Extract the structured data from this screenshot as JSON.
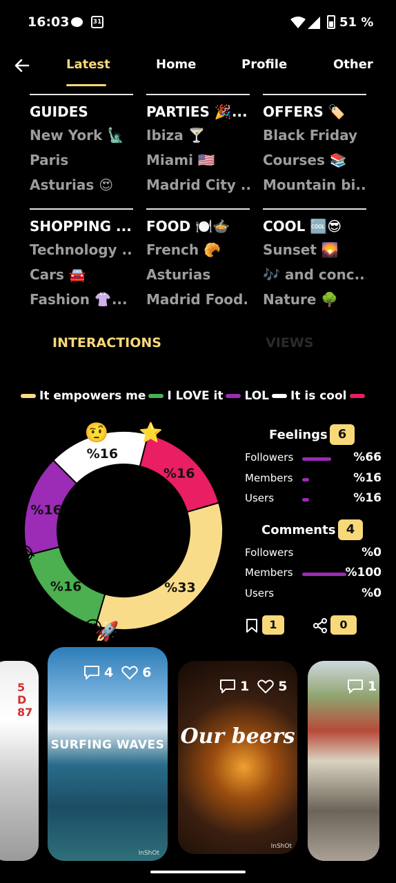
{
  "status_bar": {
    "time": "16:03",
    "calendar_day": "31",
    "battery": "51 %"
  },
  "nav": {
    "tabs": [
      "Latest",
      "Home",
      "Profile",
      "Other"
    ],
    "active_tab": "Latest"
  },
  "categories": [
    {
      "title": "GUIDES",
      "items": [
        "New York 🗽",
        "Paris",
        "Asturias 😍"
      ]
    },
    {
      "title": "PARTIES 🎉...",
      "items": [
        "Ibiza 🍸",
        "Miami 🇺🇸",
        "Madrid City ..."
      ]
    },
    {
      "title": "OFFERS 🏷️",
      "items": [
        "Black Friday",
        "Courses 📚",
        "Mountain bi..."
      ]
    },
    {
      "title": "SHOPPING ...",
      "items": [
        "Technology ...",
        "Cars 🚘",
        "Fashion 👚..."
      ]
    },
    {
      "title": "FOOD 🍽️🍲",
      "items": [
        "French 🥐",
        "Asturias",
        "Madrid Food..."
      ]
    },
    {
      "title": "COOL 🆒😎",
      "items": [
        "Sunset 🌄",
        "🎶 and conc...",
        "Nature 🌳"
      ]
    }
  ],
  "interaction_tabs": {
    "interactions": "INTERACTIONS",
    "views": "VIEWS"
  },
  "legend": [
    {
      "label": "It empowers me",
      "color": "#f8dc8a"
    },
    {
      "label": "I LOVE it",
      "color": "#4caf50"
    },
    {
      "label": "LOL",
      "color": "#9c2bb5"
    },
    {
      "label": "It is cool",
      "color": "#ffffff"
    },
    {
      "label": "",
      "color": "#e91e63"
    }
  ],
  "chart_data": {
    "type": "pie",
    "donut": true,
    "categories": [
      "It is cool",
      "Star",
      "It empowers me",
      "I LOVE it",
      "LOL"
    ],
    "values": [
      16,
      16,
      33,
      16,
      16
    ],
    "labels": [
      "%16",
      "%16",
      "%33",
      "%16",
      "%16"
    ],
    "colors": [
      "#ffffff",
      "#e91e63",
      "#f8dc8a",
      "#4caf50",
      "#9c2bb5"
    ],
    "emojis": [
      "🤨",
      "⭐",
      "🚀",
      "😍",
      "😂"
    ]
  },
  "feelings": {
    "title": "Feelings",
    "count": "6",
    "rows": [
      {
        "label": "Followers",
        "value": "%66",
        "fraction": 0.66
      },
      {
        "label": "Members",
        "value": "%16",
        "fraction": 0.16
      },
      {
        "label": "Users",
        "value": "%16",
        "fraction": 0.16
      }
    ]
  },
  "comments": {
    "title": "Comments",
    "count": "4",
    "rows": [
      {
        "label": "Followers",
        "value": "%0",
        "fraction": 0
      },
      {
        "label": "Members",
        "value": "%100",
        "fraction": 1.0
      },
      {
        "label": "Users",
        "value": "%0",
        "fraction": 0
      }
    ]
  },
  "actions": {
    "bookmarks": "1",
    "shares": "0"
  },
  "cards": [
    {
      "comments": "",
      "likes": "",
      "caption": ""
    },
    {
      "comments": "4",
      "likes": "6",
      "caption": "SURFING  WAVES",
      "watermark": "InShOt"
    },
    {
      "comments": "1",
      "likes": "5",
      "caption": "Our beers",
      "watermark": "InShOt"
    },
    {
      "comments": "1",
      "likes": "",
      "caption": ""
    }
  ]
}
